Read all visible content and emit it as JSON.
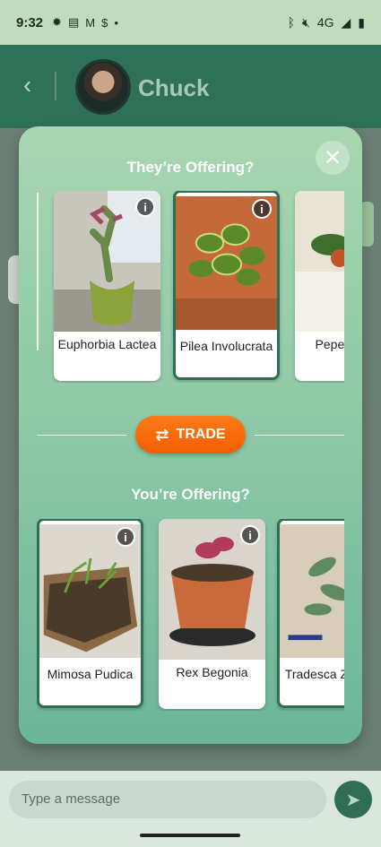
{
  "status": {
    "time": "9:32",
    "network": "4G",
    "left_icons": [
      "lightbulb-icon",
      "news-icon",
      "gmail-icon",
      "dollar-icon",
      "dot-icon"
    ],
    "right_icons": [
      "bluetooth-icon",
      "mute-icon",
      "signal-icon",
      "battery-icon"
    ]
  },
  "chat": {
    "title": "Chuck",
    "message_placeholder": "Type a message"
  },
  "modal": {
    "they_title": "They’re Offering?",
    "you_title": "You’re Offering?",
    "trade_label": "TRADE",
    "close_icon": "✕"
  },
  "they_offering": [
    {
      "name": "Euphorbia Lactea",
      "selected": false
    },
    {
      "name": "Pilea Involucrata",
      "selected": true
    },
    {
      "name": "Pepe Obtus",
      "selected": false
    }
  ],
  "you_offering": [
    {
      "name": "Mimosa Pudica",
      "selected": true
    },
    {
      "name": "Rex Begonia",
      "selected": false
    },
    {
      "name": "Tradesca Zebrin",
      "selected": true
    }
  ],
  "colors": {
    "primary": "#2f6d55",
    "accent": "#f26a0a",
    "modal_top": "#a8d6b0",
    "modal_bottom": "#6cb59a"
  }
}
